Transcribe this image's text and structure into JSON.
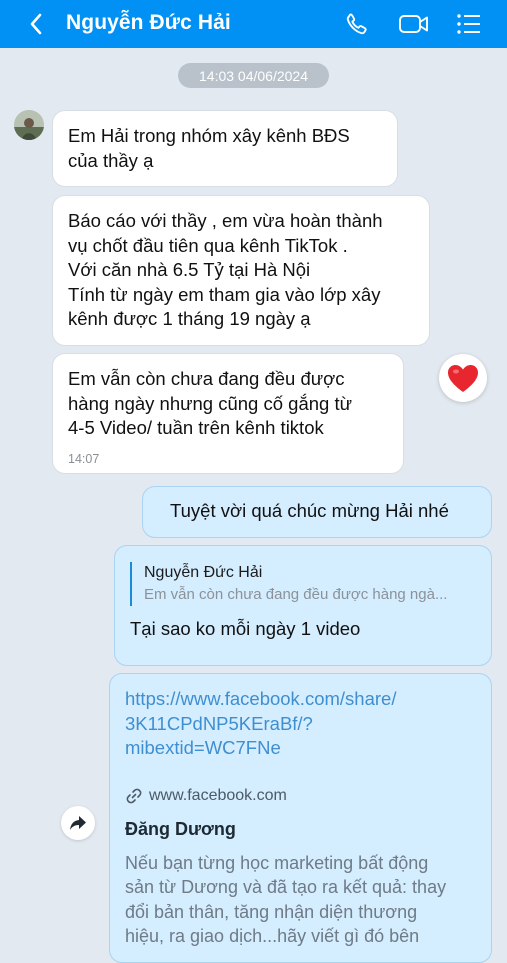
{
  "header": {
    "title": "Nguyễn Đức Hải",
    "back_icon": "chevron-left-icon",
    "call_icon": "phone-icon",
    "video_icon": "video-camera-icon",
    "menu_icon": "list-menu-icon",
    "background": "#0191f4"
  },
  "timestamp": "14:03 04/06/2024",
  "messages": [
    {
      "text": "Em Hải trong nhóm xây kênh BĐS\ncủa thầy ạ"
    },
    {
      "text": "Báo cáo với thầy , em vừa hoàn thành\nvụ chốt đầu tiên qua kênh TikTok .\nVới căn nhà 6.5 Tỷ tại Hà Nội\nTính từ ngày em tham gia vào lớp xây\nkênh được 1 tháng 19 ngày ạ"
    },
    {
      "text": "Em vẫn còn chưa đang đều được\nhàng ngày nhưng cũng cố gắng từ\n4-5 Video/ tuần trên kênh tiktok",
      "time": "14:07",
      "reaction": "heart"
    }
  ],
  "reply1": "Tuyệt vời quá chúc mừng Hải nhé",
  "reply2": {
    "quote_name": "Nguyễn Đức Hải",
    "quote_text": "Em vẫn còn chưa đang đều được hàng ngà...",
    "text": "Tại sao ko mỗi ngày 1 video"
  },
  "link_message": {
    "url_line1": "https://www.facebook.com/share/",
    "url_line2": "3K11CPdNP5KEraBf/?",
    "url_line3": "mibextid=WC7FNe",
    "domain": "www.facebook.com",
    "title": "Đăng Dương",
    "description": "Nếu bạn từng học marketing bất động\nsản từ Dương và đã tạo ra kết quả: thay\nđổi bản thân, tăng nhận diện thương\nhiệu, ra giao dịch...hãy viết gì đó bên"
  },
  "colors": {
    "incoming_bubble": "#ffffff",
    "outgoing_bubble": "#d4edff",
    "chat_background": "#e2e9f1",
    "reaction_heart": "#e8262f"
  }
}
